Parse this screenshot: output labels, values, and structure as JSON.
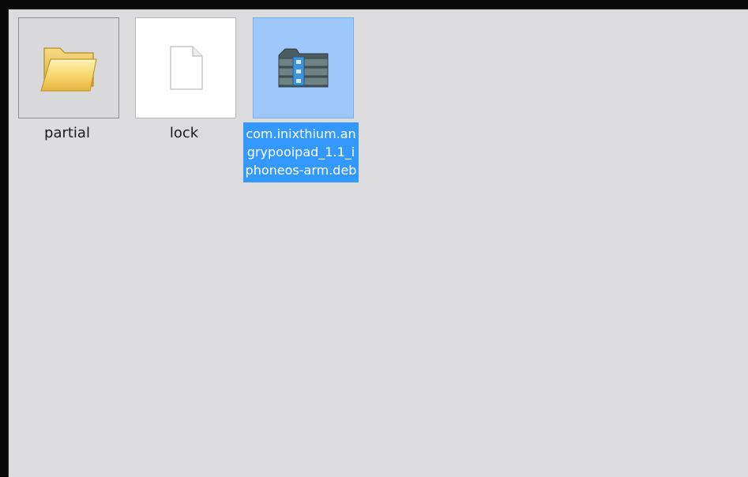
{
  "files": [
    {
      "name": "partial",
      "kind": "folder",
      "icon": "folder-icon",
      "selected": false
    },
    {
      "name": "lock",
      "kind": "file",
      "icon": "blank-file-icon",
      "selected": false
    },
    {
      "name": "com.inixthium.angrypooipad_1.1_iphoneos-arm.deb",
      "kind": "archive",
      "icon": "archive-file-icon",
      "selected": true
    }
  ],
  "colors": {
    "pane_background": "#dcdcdf",
    "selection_background": "#3399ff",
    "selected_thumb_background": "#9ec8fb",
    "folder_yellow": "#f5d36a"
  }
}
